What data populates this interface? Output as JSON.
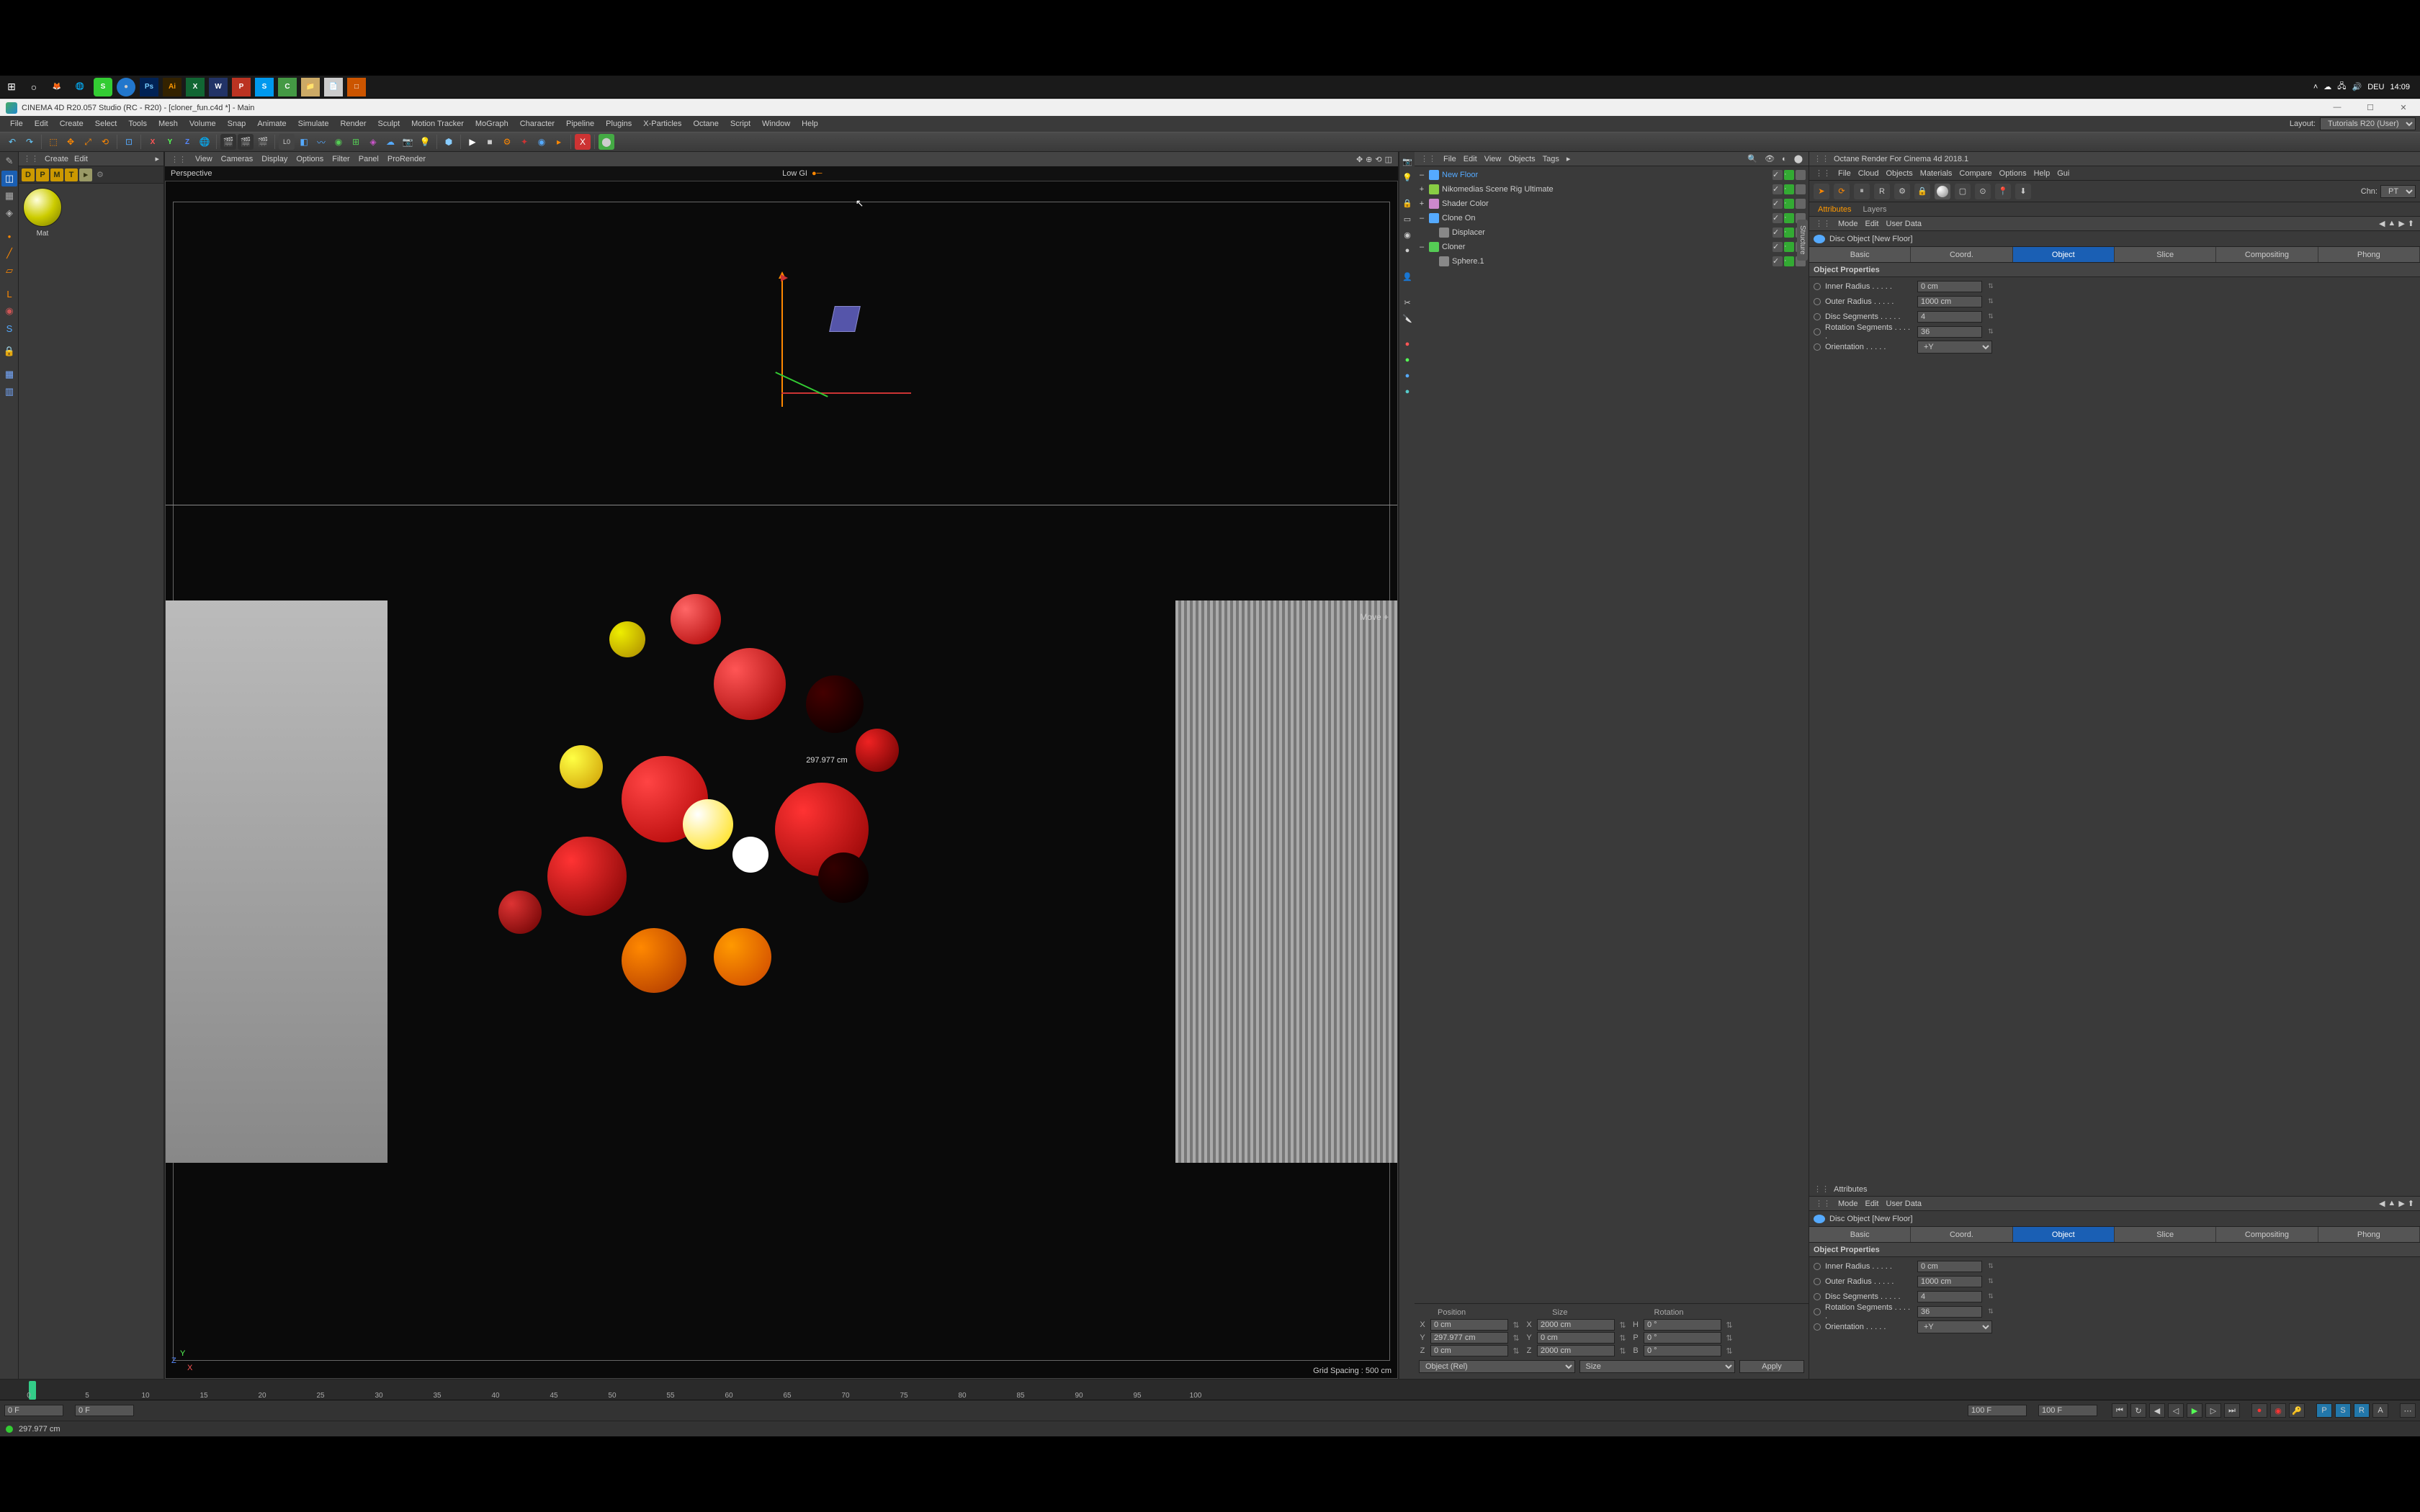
{
  "taskbar": {
    "systray": {
      "lang": "DEU",
      "time": "14:09"
    }
  },
  "titlebar": {
    "text": "CINEMA 4D R20.057 Studio (RC - R20) - [cloner_fun.c4d *] - Main"
  },
  "menubar": {
    "items": [
      "File",
      "Edit",
      "Create",
      "Select",
      "Tools",
      "Mesh",
      "Volume",
      "Snap",
      "Animate",
      "Simulate",
      "Render",
      "Sculpt",
      "Motion Tracker",
      "MoGraph",
      "Character",
      "Pipeline",
      "Plugins",
      "X-Particles",
      "Octane",
      "Script",
      "Window",
      "Help"
    ],
    "layout_label": "Layout:",
    "layout_value": "Tutorials R20 (User)"
  },
  "toolbar": {
    "axes": [
      "X",
      "Y",
      "Z"
    ],
    "L0": "L0"
  },
  "material_panel": {
    "menu": [
      "Create",
      "Edit"
    ],
    "dpmt": [
      "D",
      "P",
      "M",
      "T"
    ],
    "mat_name": "Mat"
  },
  "viewport": {
    "menu": [
      "View",
      "Cameras",
      "Display",
      "Options",
      "Filter",
      "Panel",
      "ProRender"
    ],
    "label": "Perspective",
    "render_mode": "Low GI",
    "move_hint": "Move  +",
    "center_value": "297.977 cm",
    "grid_spacing": "Grid Spacing : 500 cm",
    "corner": {
      "y": "Y",
      "z": "Z",
      "x": "X"
    }
  },
  "object_panel": {
    "menu": [
      "File",
      "Edit",
      "View",
      "Objects",
      "Tags"
    ],
    "tree": [
      {
        "name": "New Floor",
        "selected": true,
        "indent": 0,
        "icon": "#5af",
        "toggle": "–"
      },
      {
        "name": "Nikomedias Scene Rig Ultimate",
        "indent": 0,
        "icon": "#8c4",
        "toggle": "+"
      },
      {
        "name": "Shader Color",
        "indent": 0,
        "icon": "#c8c",
        "toggle": "+"
      },
      {
        "name": "Clone On",
        "indent": 0,
        "icon": "#5af",
        "toggle": "–"
      },
      {
        "name": "Displacer",
        "indent": 1,
        "icon": "#888",
        "toggle": ""
      },
      {
        "name": "Cloner",
        "indent": 0,
        "icon": "#5c5",
        "toggle": "–"
      },
      {
        "name": "Sphere.1",
        "indent": 1,
        "icon": "#888",
        "toggle": ""
      }
    ]
  },
  "coords": {
    "headers": [
      "Position",
      "Size",
      "Rotation"
    ],
    "rows": [
      {
        "axis": "X",
        "pos": "0 cm",
        "size_lbl": "X",
        "size": "2000 cm",
        "rot_lbl": "H",
        "rot": "0 °"
      },
      {
        "axis": "Y",
        "pos": "297.977 cm",
        "size_lbl": "Y",
        "size": "0 cm",
        "rot_lbl": "P",
        "rot": "0 °"
      },
      {
        "axis": "Z",
        "pos": "0 cm",
        "size_lbl": "Z",
        "size": "2000 cm",
        "rot_lbl": "B",
        "rot": "0 °"
      }
    ],
    "mode1": "Object (Rel)",
    "mode2": "Size",
    "apply": "Apply"
  },
  "octane": {
    "title": "Octane Render For Cinema 4d 2018.1",
    "menu": [
      "File",
      "Cloud",
      "Objects",
      "Materials",
      "Compare",
      "Options",
      "Help",
      "Gui"
    ],
    "chn_label": "Chn:",
    "chn_value": "PT"
  },
  "attr_tabs_top": {
    "attributes": "Attributes",
    "layers": "Layers"
  },
  "attr_menu": {
    "items": [
      "Mode",
      "Edit",
      "User Data"
    ]
  },
  "attr_object": "Disc Object [New Floor]",
  "attr_tabs": [
    "Basic",
    "Coord.",
    "Object",
    "Slice",
    "Compositing",
    "Phong"
  ],
  "attr_section": "Object Properties",
  "props": [
    {
      "label": "Inner Radius",
      "value": "0 cm"
    },
    {
      "label": "Outer Radius",
      "value": "1000 cm"
    },
    {
      "label": "Disc Segments",
      "value": "4"
    },
    {
      "label": "Rotation Segments",
      "value": "36"
    },
    {
      "label": "Orientation",
      "value": "+Y",
      "type": "select"
    }
  ],
  "attr_lower_header": "Attributes",
  "timeline": {
    "ticks": [
      "0",
      "5",
      "10",
      "15",
      "20",
      "25",
      "30",
      "35",
      "40",
      "45",
      "50",
      "55",
      "60",
      "65",
      "70",
      "75",
      "80",
      "85",
      "90",
      "95",
      "100"
    ],
    "start": "0 F",
    "current": "0 F",
    "end1": "100 F",
    "end2": "100 F"
  },
  "status": {
    "value": "297.977 cm"
  }
}
